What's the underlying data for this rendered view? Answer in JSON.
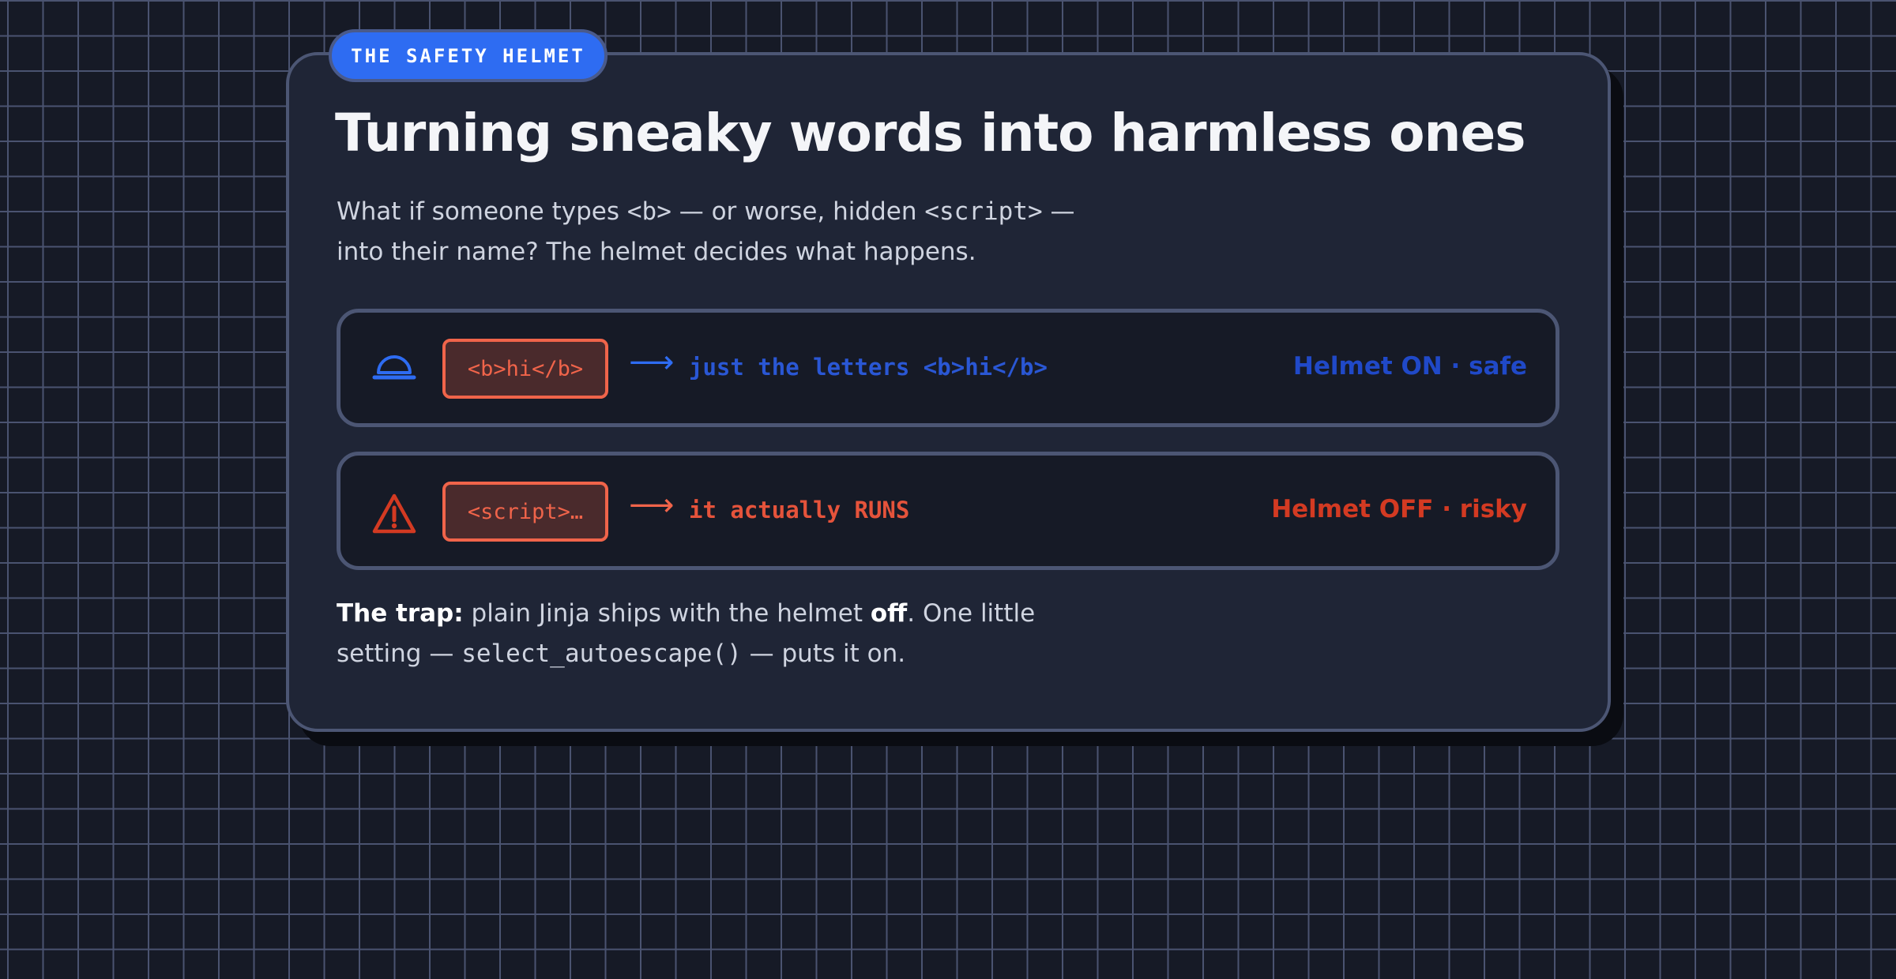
{
  "badge": "THE SAFETY HELMET",
  "title": "Turning sneaky words into harmless ones",
  "intro": {
    "p1": "What if someone types ",
    "code1": "<b>",
    "p2": " — or worse, hidden ",
    "code2": "<script>",
    "p3": " — into their name? The helmet decides what happens."
  },
  "rows": [
    {
      "icon": "helmet-icon",
      "input": "<b>hi</b>",
      "arrow": "⟶",
      "result": "just the letters <b>hi</b>",
      "status": "Helmet ON · safe",
      "color": "#2049c8"
    },
    {
      "icon": "warning-icon",
      "input": "<script>…",
      "arrow": "⟶",
      "result": "it actually RUNS",
      "status": "Helmet OFF · risky",
      "color": "#d33a22"
    }
  ],
  "footer": {
    "lead": "The trap:",
    "p1": " plain Jinja ships with the helmet ",
    "bold": "off",
    "p2": ". One little setting — ",
    "code": "select_autoescape()",
    "p3": " — puts it on."
  },
  "colors": {
    "background": "#161a26",
    "card": "#1f2536",
    "accent_blue": "#2e6cf2",
    "accent_red": "#f0644a"
  }
}
